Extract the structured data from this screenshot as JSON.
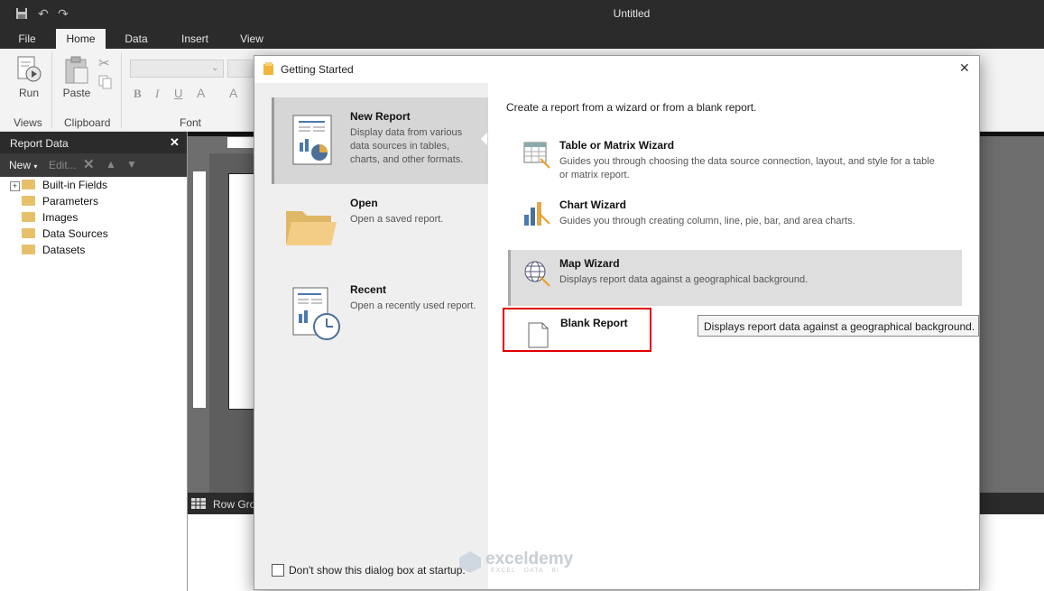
{
  "window": {
    "title": "Untitled"
  },
  "ribbon": {
    "tabs": [
      "File",
      "Home",
      "Data",
      "Insert",
      "View"
    ],
    "run_label": "Run",
    "paste_label": "Paste",
    "groups": {
      "views": "Views",
      "clipboard": "Clipboard",
      "font": "Font"
    }
  },
  "report_data": {
    "title": "Report Data",
    "new_label": "New",
    "edit_label": "Edit...",
    "items": [
      "Built-in Fields",
      "Parameters",
      "Images",
      "Data Sources",
      "Datasets"
    ]
  },
  "row_groups_label": "Row Gro",
  "dialog": {
    "title": "Getting Started",
    "close_glyph": "✕",
    "left_cards": [
      {
        "title": "New Report",
        "desc": "Display data from various data sources in tables, charts, and other formats."
      },
      {
        "title": "Open",
        "desc": "Open a saved report."
      },
      {
        "title": "Recent",
        "desc": "Open a recently used report."
      }
    ],
    "intro": "Create a report from a wizard or from a blank report.",
    "options": [
      {
        "title": "Table or Matrix Wizard",
        "desc": "Guides you through choosing the data source connection, layout, and style for a table or matrix report."
      },
      {
        "title": "Chart Wizard",
        "desc": "Guides you through creating column, line, pie, bar, and area charts."
      },
      {
        "title": "Map Wizard",
        "desc": "Displays report data against a geographical background."
      },
      {
        "title": "Blank Report",
        "desc": ""
      }
    ],
    "tooltip": "Displays report data against a geographical background.",
    "checkbox_label": "Don't show this dialog box at startup."
  },
  "watermark": {
    "brand": "exceldemy",
    "tagline": "EXCEL · DATA · BI"
  },
  "colors": {
    "highlight_border": "#e00000",
    "folder": "#e8c06a",
    "dark_chrome": "#2b2b2b"
  }
}
